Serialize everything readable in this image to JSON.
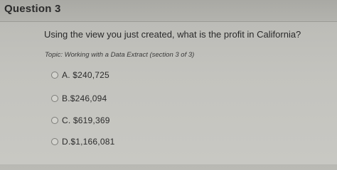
{
  "question": {
    "title": "Question 3",
    "text": "Using the view you just created, what is the profit in California?",
    "topic": "Topic: Working with a Data Extract (section 3 of 3)"
  },
  "choices": [
    {
      "label": "A. $240,725",
      "selected": false
    },
    {
      "label": "B.$246,094",
      "selected": false
    },
    {
      "label": "C. $619,369",
      "selected": false
    },
    {
      "label": "D.$1,166,081",
      "selected": false
    }
  ]
}
